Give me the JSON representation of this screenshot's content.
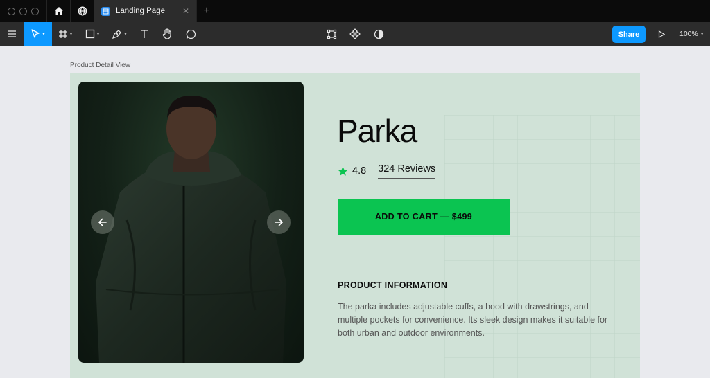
{
  "window": {
    "tab_title": "Landing Page"
  },
  "toolbar": {
    "share_label": "Share",
    "zoom_label": "100%"
  },
  "canvas": {
    "frame_label": "Product Detail View"
  },
  "product": {
    "title": "Parka",
    "rating": "4.8",
    "reviews": "324 Reviews",
    "cart_label": "ADD TO CART — $499",
    "info_heading": "PRODUCT INFORMATION",
    "info_body": "The parka includes adjustable cuffs, a hood with drawstrings, and multiple pockets for convenience. Its sleek design makes it suitable for both urban and outdoor environments."
  },
  "colors": {
    "accent": "#0d99ff",
    "cart_green": "#0bc451",
    "frame_bg": "#d0e2d7",
    "star": "#0bc451"
  },
  "icons": [
    "home-icon",
    "globe-icon",
    "menu-icon",
    "move-icon",
    "frame-icon",
    "rectangle-icon",
    "pen-icon",
    "text-icon",
    "hand-icon",
    "comment-icon",
    "component-icon",
    "assets-icon",
    "contrast-icon",
    "play-icon",
    "star-icon",
    "arrow-left-icon",
    "arrow-right-icon"
  ]
}
